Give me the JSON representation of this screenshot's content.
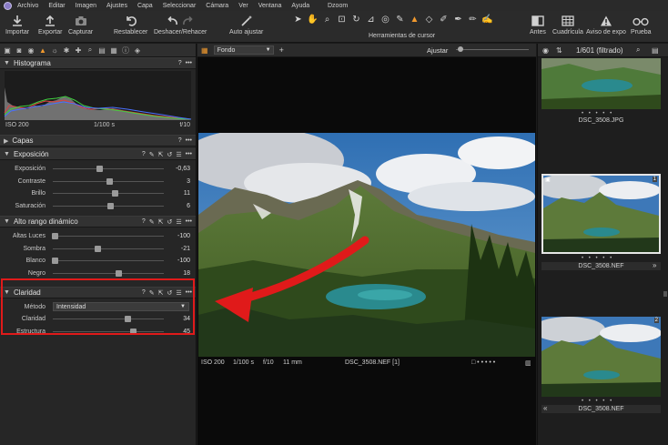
{
  "menubar": {
    "items": [
      "Archivo",
      "Editar",
      "Imagen",
      "Ajustes",
      "Capa",
      "Seleccionar",
      "Cámara",
      "Ver",
      "Ventana",
      "Ayuda"
    ],
    "app_title": "Dzoom"
  },
  "toolbar": {
    "importar": "Importar",
    "exportar": "Exportar",
    "capturar": "Capturar",
    "restablecer": "Restablecer",
    "deshacer": "Deshacer/Rehacer",
    "auto_ajustar": "Auto ajustar",
    "herramientas_cursor": "Herramientas de cursor",
    "antes": "Antes",
    "cuadricula": "Cuadrícula",
    "aviso_expo": "Aviso de expo",
    "prueba": "Prueba"
  },
  "histogram": {
    "title": "Histograma",
    "iso": "ISO 200",
    "shutter": "1/100 s",
    "aperture": "f/10"
  },
  "capas": {
    "title": "Capas"
  },
  "exposicion": {
    "title": "Exposición",
    "sliders": [
      {
        "label": "Exposición",
        "value": "-0,63",
        "pos": 0.42
      },
      {
        "label": "Contraste",
        "value": "3",
        "pos": 0.51
      },
      {
        "label": "Brillo",
        "value": "11",
        "pos": 0.56
      },
      {
        "label": "Saturación",
        "value": "6",
        "pos": 0.52
      }
    ]
  },
  "hdr": {
    "title": "Alto rango dinámico",
    "sliders": [
      {
        "label": "Altas Luces",
        "value": "-100",
        "pos": 0.02
      },
      {
        "label": "Sombra",
        "value": "-21",
        "pos": 0.4
      },
      {
        "label": "Blanco",
        "value": "-100",
        "pos": 0.02
      },
      {
        "label": "Negro",
        "value": "18",
        "pos": 0.59
      }
    ]
  },
  "claridad": {
    "title": "Claridad",
    "metodo_label": "Método",
    "metodo_value": "Intensidad",
    "sliders": [
      {
        "label": "Claridad",
        "value": "34",
        "pos": 0.67
      },
      {
        "label": "Estructura",
        "value": "45",
        "pos": 0.72
      }
    ]
  },
  "viewer": {
    "background_select": "Fondo",
    "zoom_label": "Ajustar",
    "meta": {
      "iso": "ISO 200",
      "shutter": "1/100 s",
      "aperture": "f/10",
      "focal": "11 mm",
      "filename": "DSC_3508.NEF [1]"
    }
  },
  "browser": {
    "count": "1/601 (filtrado)",
    "thumbs": [
      {
        "name": "DSC_3508.JPG"
      },
      {
        "name": "DSC_3508.NEF",
        "badge": "1"
      },
      {
        "name": "DSC_3508.NEF",
        "badge": "2"
      }
    ]
  },
  "colors": {
    "accent": "#f29a2e",
    "annotation_red": "#e01a1a"
  }
}
